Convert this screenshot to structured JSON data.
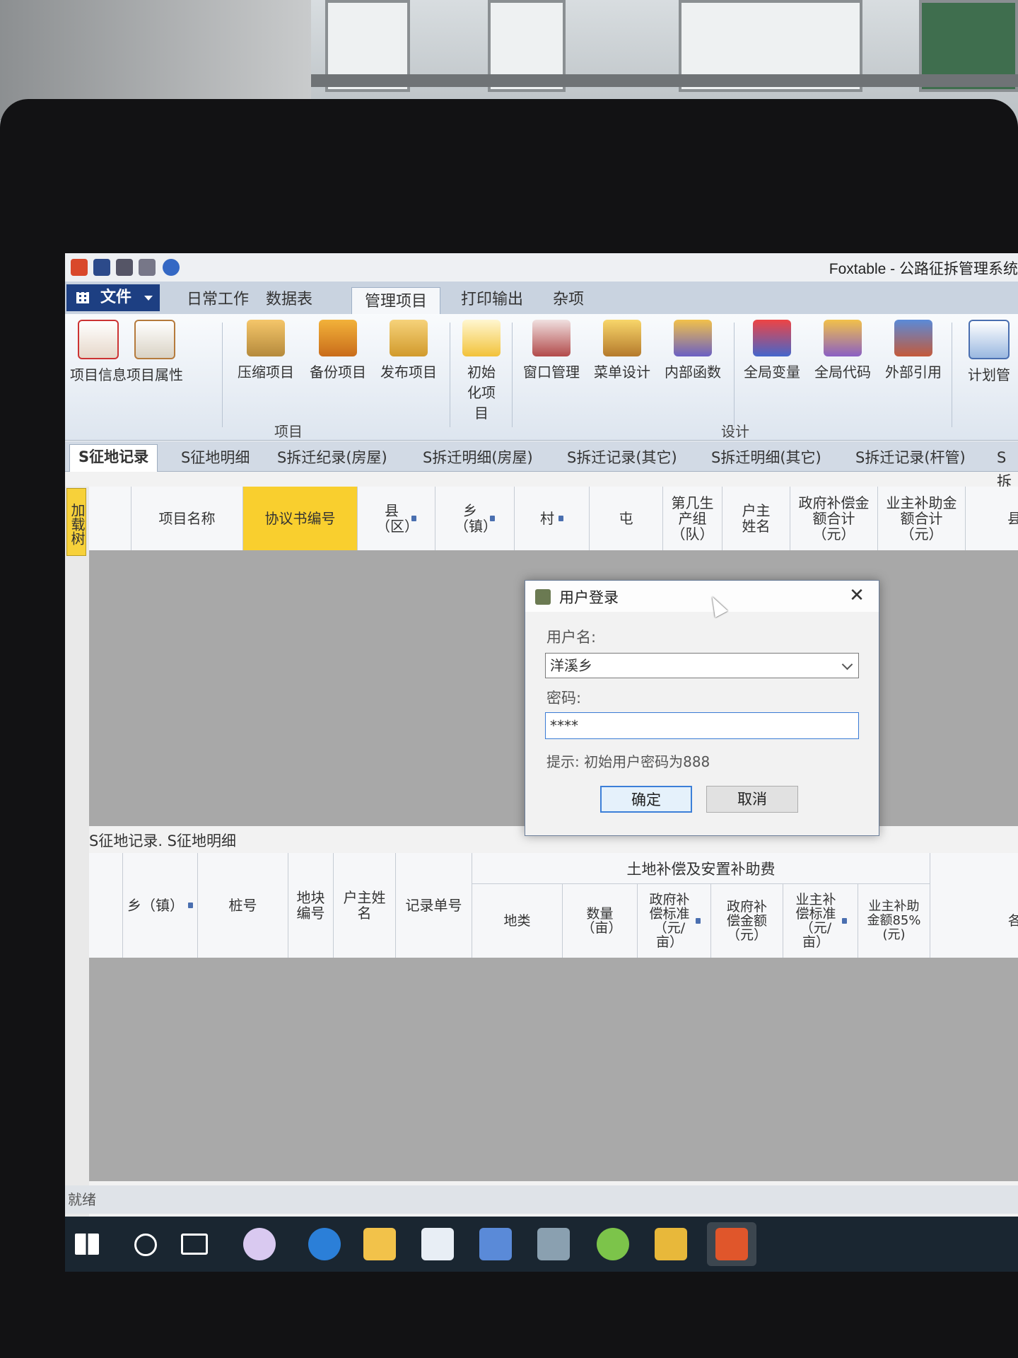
{
  "app": {
    "title": "Foxtable - 公路征拆管理系统"
  },
  "menu": {
    "file_label": "文件",
    "tabs": [
      "日常工作",
      "数据表",
      "管理项目",
      "打印输出",
      "杂项"
    ],
    "active_tab": "管理项目"
  },
  "ribbon": {
    "buttons": [
      {
        "label": "项目信息",
        "icon": "project-info-icon"
      },
      {
        "label": "项目属性",
        "icon": "project-properties-icon"
      },
      {
        "label": "压缩项目",
        "icon": "compress-icon"
      },
      {
        "label": "备份项目",
        "icon": "backup-icon"
      },
      {
        "label": "发布项目",
        "icon": "publish-icon"
      },
      {
        "label": "初始化项目",
        "icon": "initialize-icon"
      },
      {
        "label": "窗口管理",
        "icon": "window-manager-icon"
      },
      {
        "label": "菜单设计",
        "icon": "menu-design-icon"
      },
      {
        "label": "内部函数",
        "icon": "internal-function-icon"
      },
      {
        "label": "全局变量",
        "icon": "global-variable-icon"
      },
      {
        "label": "全局代码",
        "icon": "global-code-icon"
      },
      {
        "label": "外部引用",
        "icon": "external-reference-icon"
      },
      {
        "label": "计划管",
        "icon": "schedule-icon"
      }
    ],
    "groups": [
      "项目",
      "设计"
    ]
  },
  "sheet_tabs": [
    "S征地记录",
    "S征地明细",
    "S拆迁纪录(房屋)",
    "S拆迁明细(房屋)",
    "S拆迁记录(其它)",
    "S拆迁明细(其它)",
    "S拆迁记录(杆管)",
    "S拆"
  ],
  "side_tab": "加载树",
  "grid1": {
    "columns": [
      "项目名称",
      "协议书编号",
      "县（区）",
      "乡（镇）",
      "村",
      "屯",
      "第几生产组（队）",
      "户主姓名",
      "政府补偿金额合计（元）",
      "业主补助金额合计（元）",
      "县"
    ],
    "selected_column": "协议书编号"
  },
  "subgrid_path": "S征地记录. S征地明细",
  "grid2": {
    "columns": [
      "乡（镇）",
      "桩号",
      "地块编号",
      "户主姓名",
      "记录单号"
    ],
    "group_header": "土地补偿及安置补助费",
    "group_columns": [
      "地类",
      "数量（亩）",
      "政府补偿标准（元/亩）",
      "政府补偿金额（元）",
      "业主补偿标准（元/亩）",
      "业主补助金额85%(元)",
      "各"
    ]
  },
  "status": {
    "text": "就绪"
  },
  "dialog": {
    "title": "用户登录",
    "close_label": "✕",
    "username_label": "用户名:",
    "username_value": "洋溪乡",
    "password_label": "密码:",
    "password_value": "****",
    "hint": "提示: 初始用户密码为888",
    "ok_label": "确定",
    "cancel_label": "取消"
  },
  "taskbar": {
    "icons": [
      "windows-start-icon",
      "search-circle-icon",
      "task-view-icon",
      "pinwheel-app-icon",
      "edge-browser-icon",
      "file-explorer-icon",
      "store-icon",
      "document-app-icon",
      "photo-app-icon",
      "chat-app-icon",
      "help-app-icon",
      "foxtable-app-icon"
    ]
  },
  "colors": {
    "file_button": "#1d3f82",
    "selected_column": "#f9cf2e",
    "grid_body": "#a8a8a8",
    "taskbar": "#1a2631"
  }
}
